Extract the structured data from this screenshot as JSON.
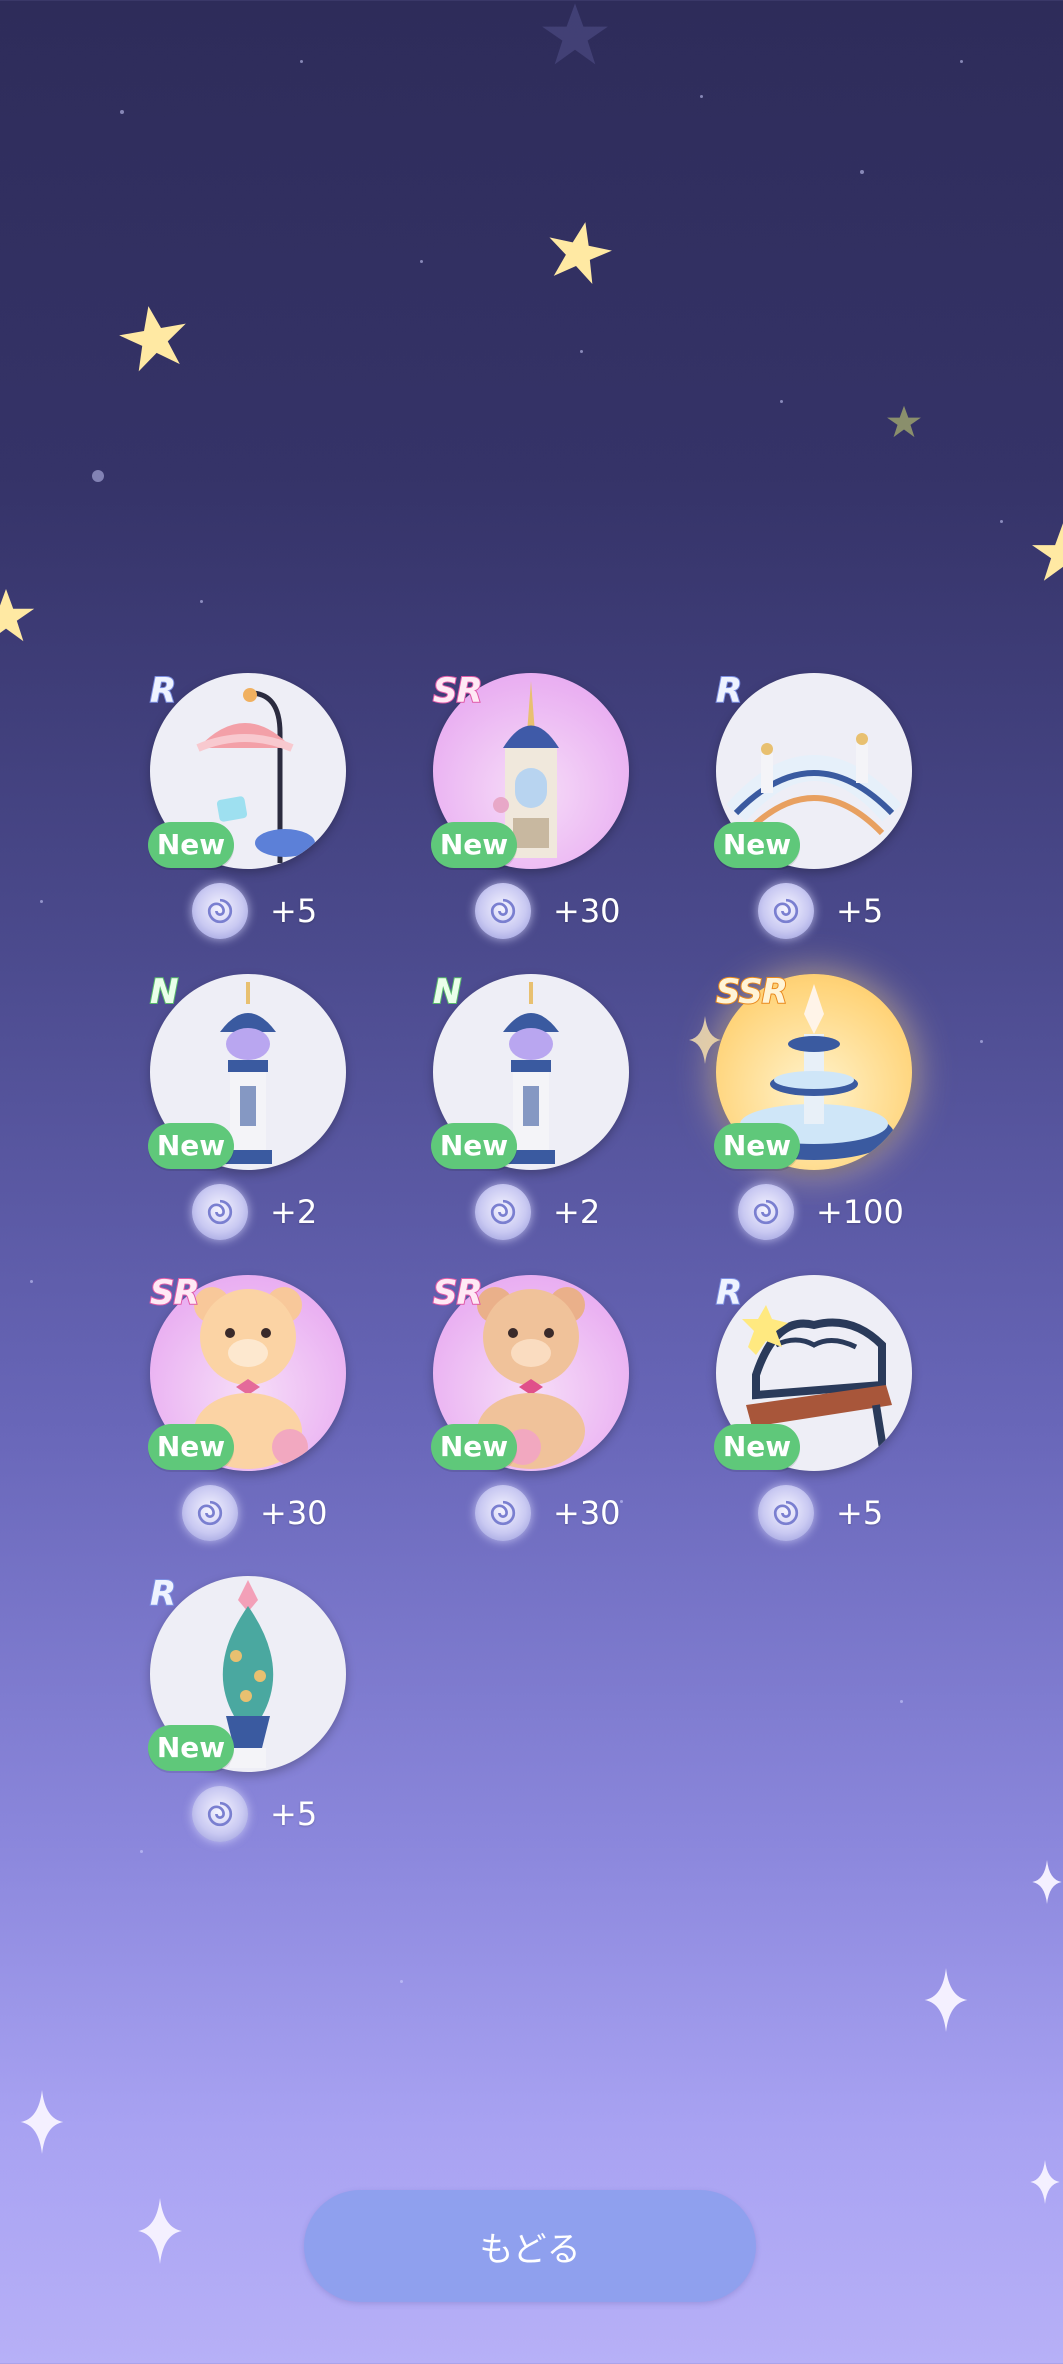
{
  "items": [
    {
      "rarity": "R",
      "new_label": "New",
      "reward": "+5",
      "icon": "umbrella-lamp-icon",
      "bg": "plain"
    },
    {
      "rarity": "SR",
      "new_label": "New",
      "reward": "+30",
      "icon": "clock-tower-icon",
      "bg": "sr"
    },
    {
      "rarity": "R",
      "new_label": "New",
      "reward": "+5",
      "icon": "bridge-icon",
      "bg": "plain"
    },
    {
      "rarity": "N",
      "new_label": "New",
      "reward": "+2",
      "icon": "lamp-pillar-icon",
      "bg": "plain"
    },
    {
      "rarity": "N",
      "new_label": "New",
      "reward": "+2",
      "icon": "lamp-pillar-icon",
      "bg": "plain"
    },
    {
      "rarity": "SSR",
      "new_label": "New",
      "reward": "+100",
      "icon": "fountain-icon",
      "bg": "ssr"
    },
    {
      "rarity": "SR",
      "new_label": "New",
      "reward": "+30",
      "icon": "teddy-bear-icon",
      "bg": "sr"
    },
    {
      "rarity": "SR",
      "new_label": "New",
      "reward": "+30",
      "icon": "teddy-bear-icon",
      "bg": "sr"
    },
    {
      "rarity": "R",
      "new_label": "New",
      "reward": "+5",
      "icon": "bench-icon",
      "bg": "plain"
    },
    {
      "rarity": "R",
      "new_label": "New",
      "reward": "+5",
      "icon": "topiary-vase-icon",
      "bg": "plain"
    }
  ],
  "back_button": {
    "label": "もどる"
  },
  "colors": {
    "new_badge": "#5fc87a",
    "button": "#8fa0ee"
  }
}
